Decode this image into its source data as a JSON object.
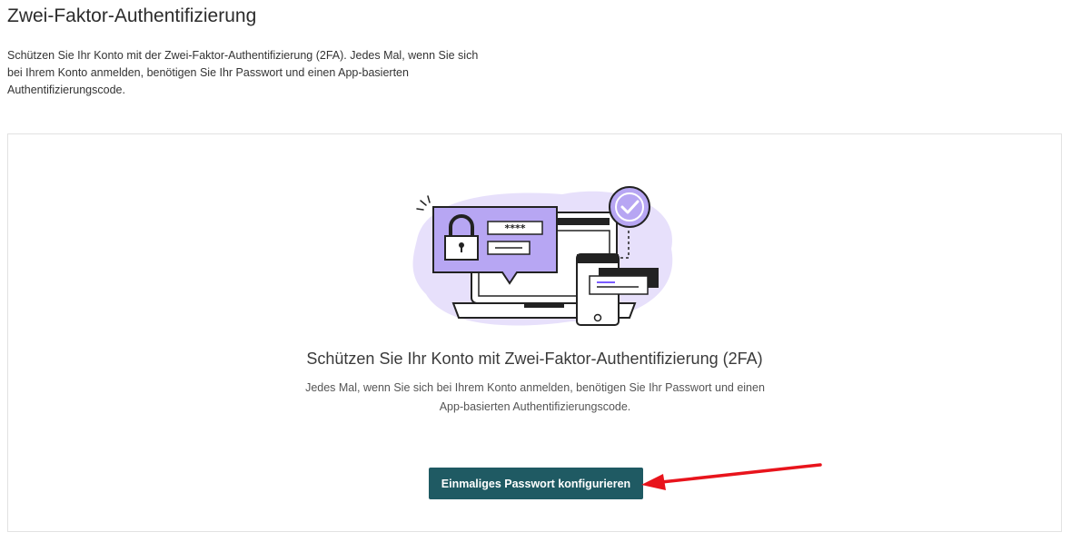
{
  "page": {
    "title": "Zwei-Faktor-Authentifizierung",
    "intro": "Schützen Sie Ihr Konto mit der Zwei-Faktor-Authentifizierung (2FA). Jedes Mal, wenn Sie sich bei Ihrem Konto anmelden, benötigen Sie Ihr Passwort und einen App-basierten Authentifizierungscode."
  },
  "card": {
    "title": "Schützen Sie Ihr Konto mit Zwei-Faktor-Authentifizierung (2FA)",
    "description": "Jedes Mal, wenn Sie sich bei Ihrem Konto anmelden, benötigen Sie Ihr Passwort und einen App-basierten Authentifizierungscode.",
    "button_label": "Einmaliges Passwort konfigurieren",
    "password_mask": "****"
  },
  "colors": {
    "accent": "#1f5a63",
    "illustration_purple": "#b7a6f3",
    "annotation_arrow": "#e8141c"
  },
  "icons": [
    "lock-icon",
    "check-circle-icon",
    "laptop-icon",
    "phone-icon",
    "annotation-arrow-icon"
  ]
}
